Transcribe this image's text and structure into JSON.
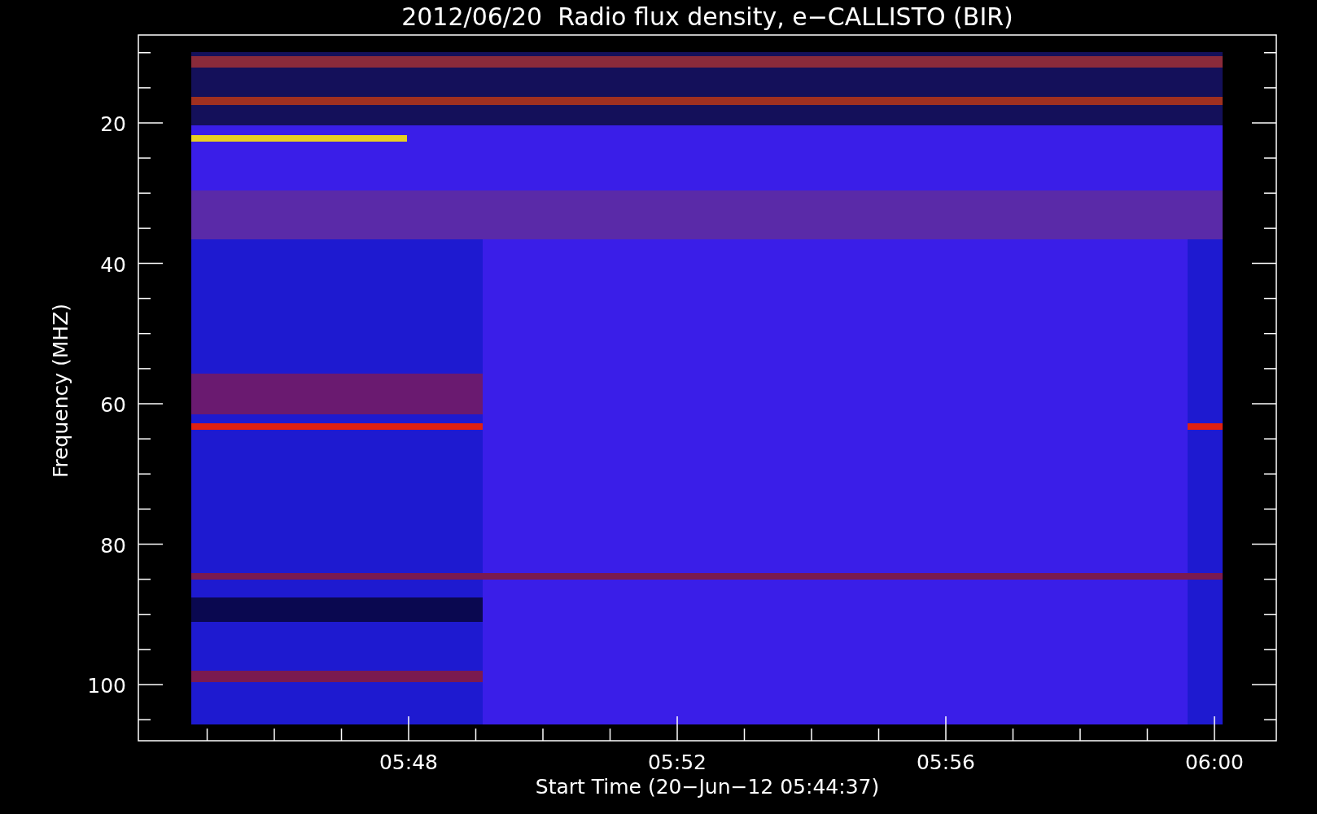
{
  "title": "2012/06/20  Radio flux density, e−CALLISTO (BIR)",
  "ylabel": "Frequency (MHZ)",
  "xlabel": "Start Time (20−Jun−12 05:44:37)",
  "yticks": [
    "20",
    "40",
    "60",
    "80",
    "100"
  ],
  "xticks": [
    "05:48",
    "05:52",
    "05:56",
    "06:00"
  ],
  "spectrogram": {
    "kind": "picture"
  }
}
